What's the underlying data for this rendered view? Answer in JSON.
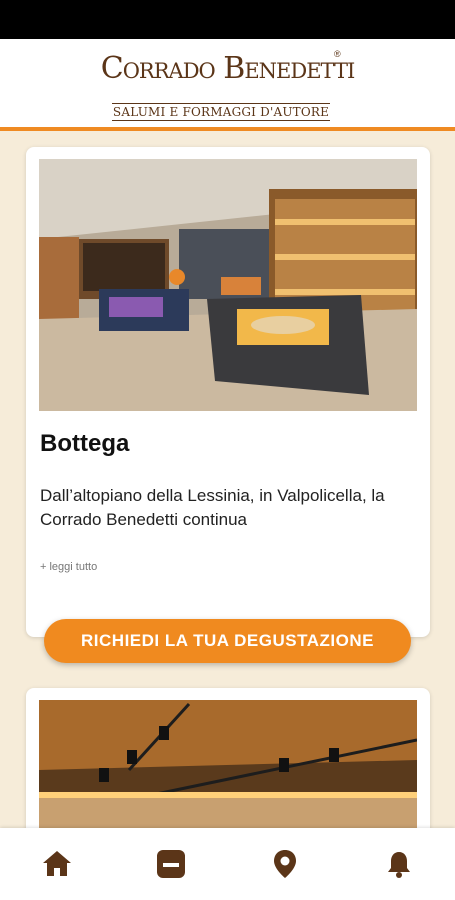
{
  "header": {
    "brand_name": "Corrado Benedetti",
    "registered_mark": "®",
    "tagline": "SALUMI E FORMAGGI D'AUTORE"
  },
  "cards": [
    {
      "title": "Bottega",
      "description": "Dall’altopiano della Lessinia, in Valpolicella, la Corrado Benedetti continua",
      "read_more": "+ leggi tutto",
      "photo_icon": "shop-interior-photo"
    },
    {
      "photo_icon": "cellar-interior-photo"
    }
  ],
  "cta": {
    "label": "RICHIEDI LA TUA DEGUSTAZIONE"
  },
  "bottom_nav": {
    "items": [
      {
        "icon": "home-icon"
      },
      {
        "icon": "menu-card-icon"
      },
      {
        "icon": "location-pin-icon"
      },
      {
        "icon": "bell-icon"
      }
    ]
  },
  "colors": {
    "accent": "#f08a1f",
    "brand_brown": "#5b3518",
    "background": "#f6ecd9"
  }
}
